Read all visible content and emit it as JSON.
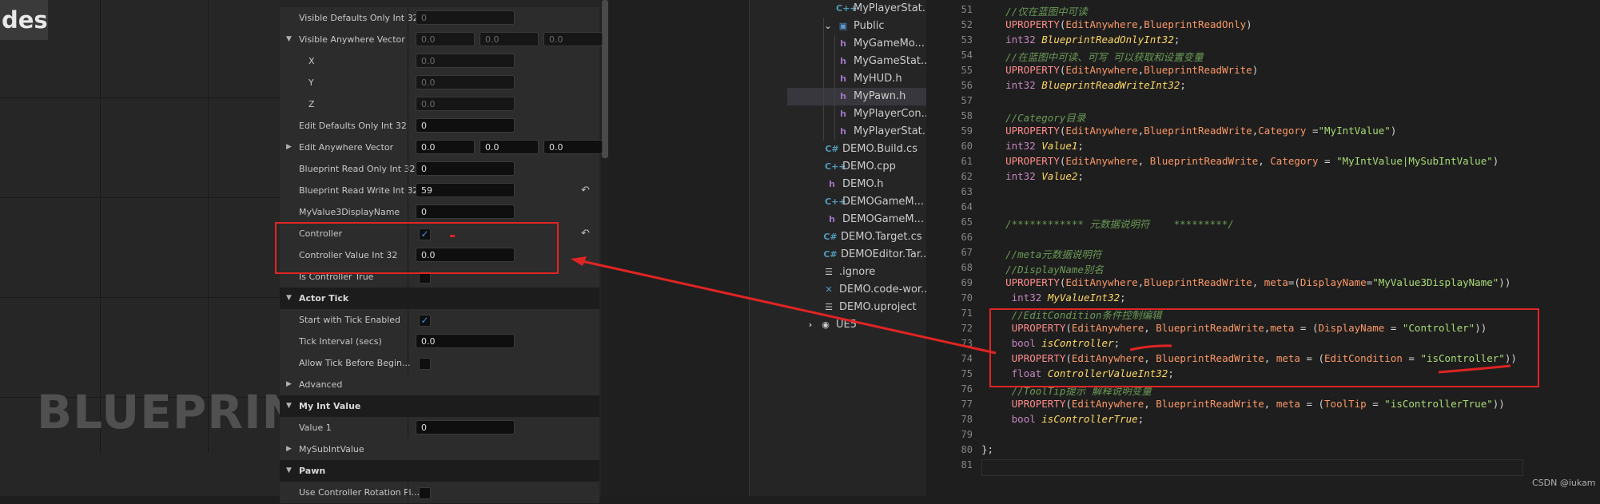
{
  "blueprint": {
    "tag_text": "des.",
    "watermark": "BLUEPRINT"
  },
  "details": {
    "rows": [
      {
        "type": "prop",
        "label": "Visible Defaults Only Int 32",
        "values": [
          "0"
        ],
        "dim": true
      },
      {
        "type": "prop",
        "label": "Visible Anywhere Vector",
        "values": [
          "0.0",
          "0.0",
          "0.0"
        ],
        "dim": true,
        "caret": "down"
      },
      {
        "type": "prop",
        "label": "X",
        "values": [
          "0.0"
        ],
        "dim": true,
        "indent": true
      },
      {
        "type": "prop",
        "label": "Y",
        "values": [
          "0.0"
        ],
        "dim": true,
        "indent": true
      },
      {
        "type": "prop",
        "label": "Z",
        "values": [
          "0.0"
        ],
        "dim": true,
        "indent": true
      },
      {
        "type": "prop",
        "label": "Edit Defaults Only Int 32",
        "values": [
          "0"
        ]
      },
      {
        "type": "prop",
        "label": "Edit Anywhere Vector",
        "values": [
          "0.0",
          "0.0",
          "0.0"
        ],
        "caret": "right"
      },
      {
        "type": "prop",
        "label": "Blueprint Read Only Int 32",
        "values": [
          "0"
        ]
      },
      {
        "type": "prop",
        "label": "Blueprint Read Write Int 32",
        "values": [
          "59"
        ],
        "reset": true
      },
      {
        "type": "prop",
        "label": "MyValue3DisplayName",
        "values": [
          "0"
        ]
      },
      {
        "type": "check",
        "label": "Controller",
        "checked": true,
        "reset": true
      },
      {
        "type": "prop",
        "label": "Controller Value Int 32",
        "values": [
          "0.0"
        ]
      },
      {
        "type": "check",
        "label": "Is Controller True",
        "checked": false
      },
      {
        "type": "cat",
        "label": "Actor Tick"
      },
      {
        "type": "check",
        "label": "Start with Tick Enabled",
        "checked": true
      },
      {
        "type": "prop",
        "label": "Tick Interval (secs)",
        "values": [
          "0.0"
        ]
      },
      {
        "type": "check",
        "label": "Allow Tick Before Begin...",
        "checked": false
      },
      {
        "type": "sub",
        "label": "Advanced"
      },
      {
        "type": "cat",
        "label": "My Int Value"
      },
      {
        "type": "prop",
        "label": "Value 1",
        "values": [
          "0"
        ]
      },
      {
        "type": "sub",
        "label": "MySubIntValue"
      },
      {
        "type": "cat",
        "label": "Pawn"
      },
      {
        "type": "check",
        "label": "Use Controller Rotation Pi...",
        "checked": false
      }
    ],
    "icons": {
      "reset": "reset-arrow-icon",
      "check": "checkmark-icon"
    }
  },
  "explorer": {
    "items": [
      {
        "icon": "C++",
        "label": "MyPlayerStat..."
      },
      {
        "icon": "folder",
        "label": "Public",
        "expanded": true
      },
      {
        "icon": "h",
        "label": "MyGameMo..."
      },
      {
        "icon": "h",
        "label": "MyGameStat..."
      },
      {
        "icon": "h",
        "label": "MyHUD.h"
      },
      {
        "icon": "h",
        "label": "MyPawn.h",
        "selected": true
      },
      {
        "icon": "h",
        "label": "MyPlayerCon..."
      },
      {
        "icon": "h",
        "label": "MyPlayerStat..."
      },
      {
        "icon": "C#",
        "label": "DEMO.Build.cs"
      },
      {
        "icon": "C++",
        "label": "DEMO.cpp"
      },
      {
        "icon": "h",
        "label": "DEMO.h"
      },
      {
        "icon": "C++",
        "label": "DEMOGameM..."
      },
      {
        "icon": "h",
        "label": "DEMOGameM..."
      },
      {
        "icon": "C#",
        "label": "DEMO.Target.cs"
      },
      {
        "icon": "C#",
        "label": "DEMOEditor.Tar..."
      },
      {
        "icon": "file",
        "label": ".ignore"
      },
      {
        "icon": "vs",
        "label": "DEMO.code-wor..."
      },
      {
        "icon": "file",
        "label": "DEMO.uproject"
      },
      {
        "icon": "ue",
        "label": "UE5"
      }
    ]
  },
  "editor": {
    "lines": [
      {
        "n": "51",
        "t": "    //仅在蓝图中可读"
      },
      {
        "n": "52",
        "t": "    UPROPERTY(EditAnywhere,BlueprintReadOnly)"
      },
      {
        "n": "53",
        "t": "    int32 BlueprintReadOnlyInt32;"
      },
      {
        "n": "54",
        "t": "    //在蓝图中可读、可写 可以获取和设置变量"
      },
      {
        "n": "55",
        "t": "    UPROPERTY(EditAnywhere,BlueprintReadWrite)"
      },
      {
        "n": "56",
        "t": "    int32 BlueprintReadWriteInt32;"
      },
      {
        "n": "57",
        "t": ""
      },
      {
        "n": "58",
        "t": "    //Category目录"
      },
      {
        "n": "59",
        "t": "    UPROPERTY(EditAnywhere,BlueprintReadWrite,Category =\"MyIntValue\")"
      },
      {
        "n": "60",
        "t": "    int32 Value1;"
      },
      {
        "n": "61",
        "t": "    UPROPERTY(EditAnywhere, BlueprintReadWrite, Category = \"MyIntValue|MySubIntValue\")"
      },
      {
        "n": "62",
        "t": "    int32 Value2;"
      },
      {
        "n": "63",
        "t": ""
      },
      {
        "n": "64",
        "t": ""
      },
      {
        "n": "65",
        "t": "    /************ 元数据说明符    *********/"
      },
      {
        "n": "66",
        "t": ""
      },
      {
        "n": "67",
        "t": "    //meta元数据说明符"
      },
      {
        "n": "68",
        "t": "    //DisplayName别名"
      },
      {
        "n": "69",
        "t": "    UPROPERTY(EditAnywhere,BlueprintReadWrite, meta=(DisplayName=\"MyValue3DisplayName\"))"
      },
      {
        "n": "70",
        "t": "     int32 MyValueInt32;"
      },
      {
        "n": "71",
        "t": "     //EditCondition条件控制编辑"
      },
      {
        "n": "72",
        "t": "     UPROPERTY(EditAnywhere, BlueprintReadWrite,meta = (DisplayName = \"Controller\"))"
      },
      {
        "n": "73",
        "t": "     bool isController;"
      },
      {
        "n": "74",
        "t": "     UPROPERTY(EditAnywhere, BlueprintReadWrite, meta = (EditCondition = \"isController\"))"
      },
      {
        "n": "75",
        "t": "     float ControllerValueInt32;"
      },
      {
        "n": "76",
        "t": "     //ToolTip提示 解释说明变量"
      },
      {
        "n": "77",
        "t": "     UPROPERTY(EditAnywhere, BlueprintReadWrite, meta = (ToolTip = \"isControllerTrue\"))"
      },
      {
        "n": "78",
        "t": "     bool isControllerTrue;"
      },
      {
        "n": "79",
        "t": ""
      },
      {
        "n": "80",
        "t": "};"
      },
      {
        "n": "81",
        "t": ""
      }
    ],
    "watermark": "CSDN @iukam"
  },
  "colors": {
    "accent": "#e02424",
    "check": "#3b8fe8"
  }
}
